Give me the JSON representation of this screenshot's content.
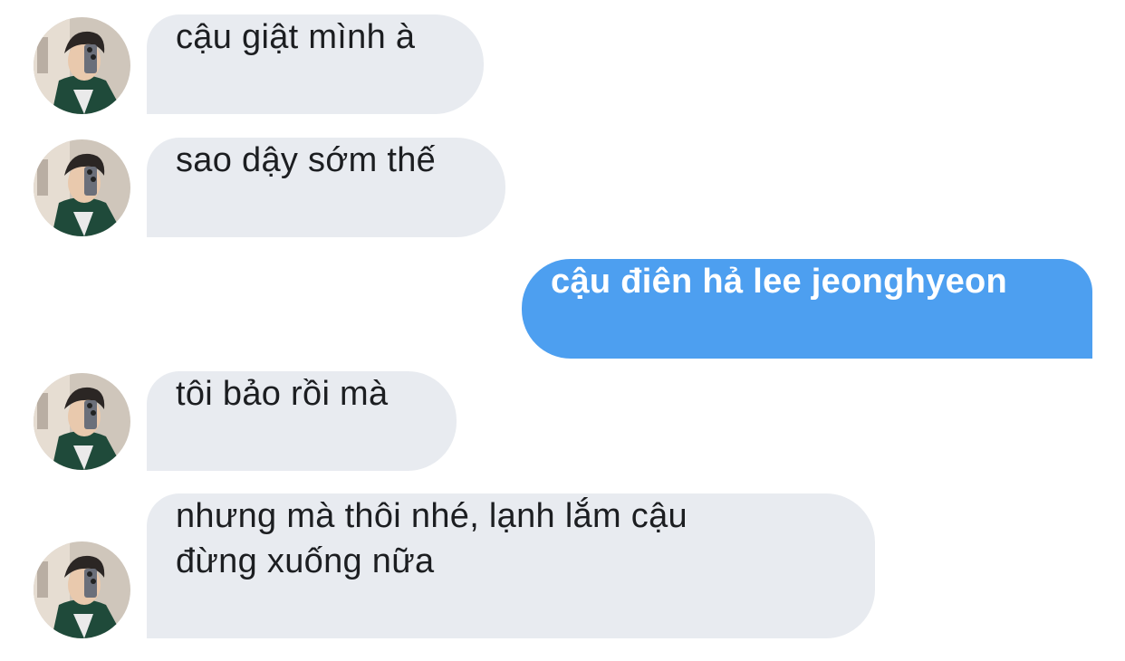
{
  "messages": [
    {
      "direction": "incoming",
      "text": "cậu giật mình à",
      "avatar": "avatar-photo"
    },
    {
      "direction": "incoming",
      "text": "sao dậy sớm thế",
      "avatar": "avatar-photo"
    },
    {
      "direction": "outgoing",
      "text": "cậu điên hả lee jeonghyeon"
    },
    {
      "direction": "incoming",
      "text": "tôi bảo rồi mà",
      "avatar": "avatar-photo"
    },
    {
      "direction": "incoming",
      "lines": [
        "nhưng mà thôi nhé, lạnh lắm cậu",
        "đừng xuống nữa"
      ],
      "avatar": "avatar-photo"
    }
  ],
  "colors": {
    "background": "#ffffff",
    "incoming_bubble": "#e8ebf0",
    "outgoing_bubble": "#4d9ff0",
    "incoming_text": "#1c1e21",
    "outgoing_text": "#ffffff"
  }
}
